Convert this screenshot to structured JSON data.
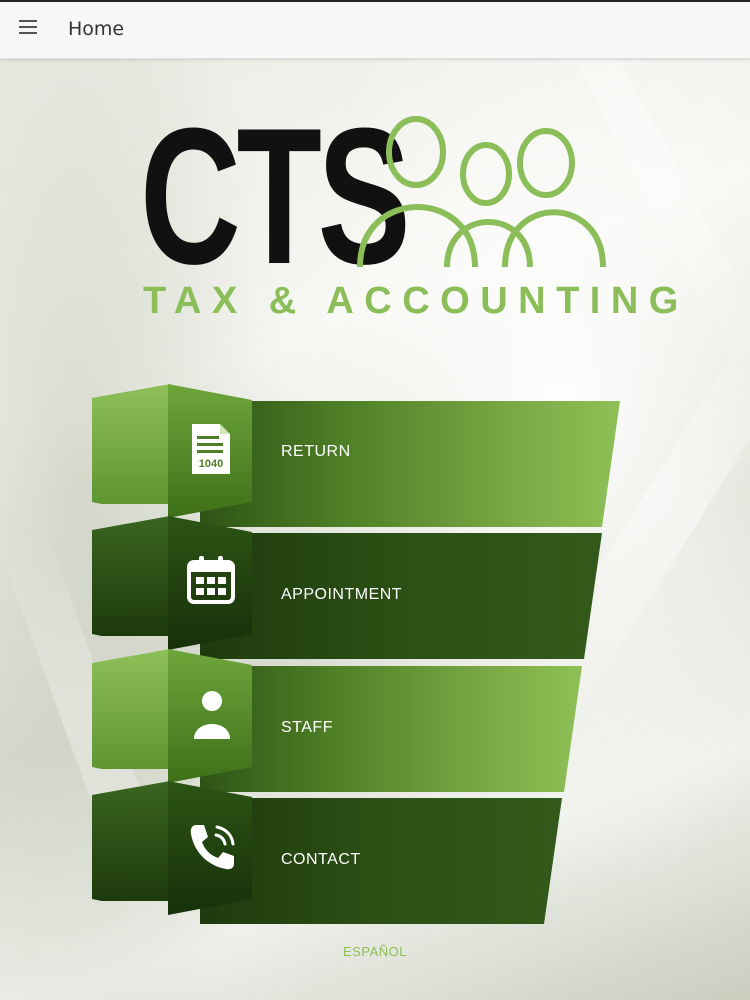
{
  "appbar": {
    "title": "Home",
    "menu_icon": "hamburger-menu-icon"
  },
  "logo": {
    "brand": "CTS",
    "tagline": "TAX & ACCOUNTING",
    "brand_color": "#111111",
    "accent_color": "#8bbd58"
  },
  "menu": {
    "items": [
      {
        "label": "RETURN",
        "icon": "tax-form-1040-icon",
        "icon_text": "1040",
        "style": "light"
      },
      {
        "label": "APPOINTMENT",
        "icon": "calendar-icon",
        "style": "dark"
      },
      {
        "label": "STAFF",
        "icon": "person-icon",
        "style": "light"
      },
      {
        "label": "CONTACT",
        "icon": "phone-icon",
        "style": "dark"
      }
    ]
  },
  "footer": {
    "language_link": "ESPAÑOL"
  }
}
